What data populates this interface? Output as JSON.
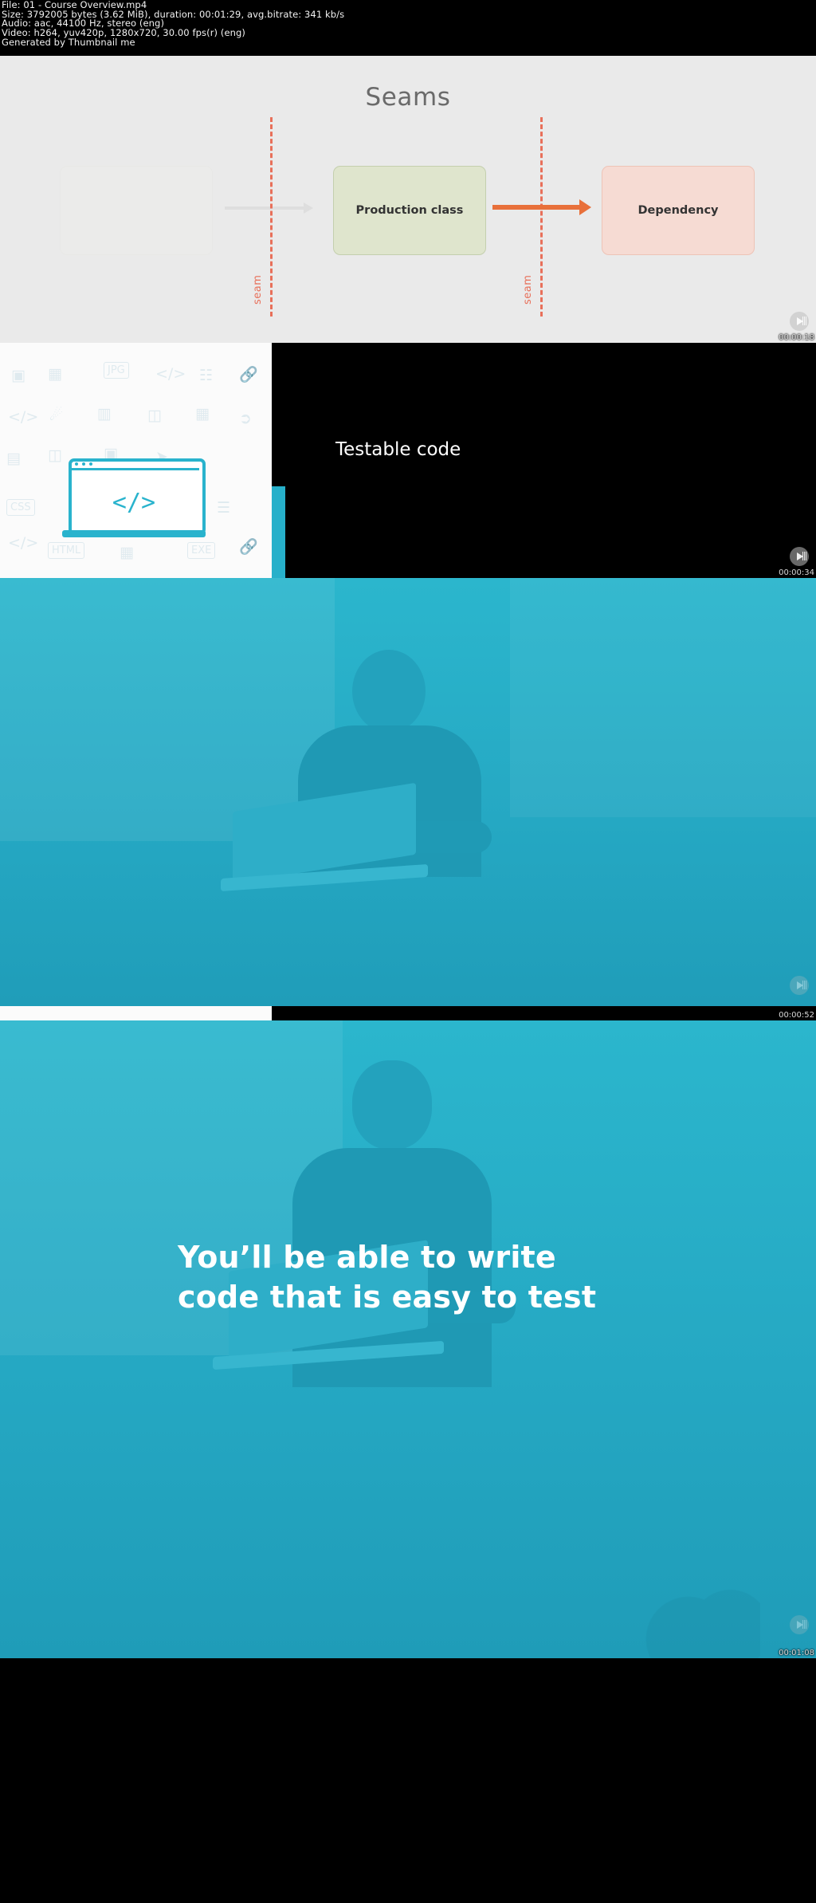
{
  "meta": {
    "file_line": "File: 01 - Course Overview.mp4",
    "size_line": "Size: 3792005 bytes (3.62 MiB), duration: 00:01:29, avg.bitrate: 341 kb/s",
    "audio_line": "Audio: aac, 44100 Hz, stereo (eng)",
    "video_line": "Video: h264, yuv420p, 1280x720, 30.00 fps(r) (eng)",
    "generator_line": "Generated by Thumbnail me"
  },
  "frames": [
    {
      "name": "seams-diagram",
      "timestamp": "00:00:18",
      "title": "Seams",
      "nodes": [
        {
          "label": "Production class"
        },
        {
          "label": "Dependency"
        }
      ],
      "seam_labels": [
        "seam",
        "seam"
      ],
      "colors": {
        "background": "#eaeaea",
        "seam": "#e8705a",
        "arrow": "#e8703a",
        "production_fill": "#dfe5cd",
        "dependency_fill": "#f6dbd3",
        "title_text": "#6a6a6a"
      }
    },
    {
      "name": "testable-code-title",
      "timestamp": "00:00:34",
      "heading": "Testable code",
      "code_glyph": "</>",
      "colors": {
        "accent": "#27b0ca",
        "panel": "#000000",
        "pattern_bg": "#fbfbfb"
      },
      "pattern_icons": [
        "CSS",
        "HTML",
        "JPG",
        "EXE",
        "</>",
        "</>",
        "</>"
      ]
    },
    {
      "name": "developer-photo",
      "timestamp": "00:00:52",
      "colors": {
        "tint": "#27b0ca"
      }
    },
    {
      "name": "closing-statement",
      "timestamp": "00:01:08",
      "caption_line1": "You’ll be able to write",
      "caption_line2": "code that is easy to test",
      "colors": {
        "tint": "#27b0ca",
        "caption_text": "#ffffff"
      }
    }
  ]
}
